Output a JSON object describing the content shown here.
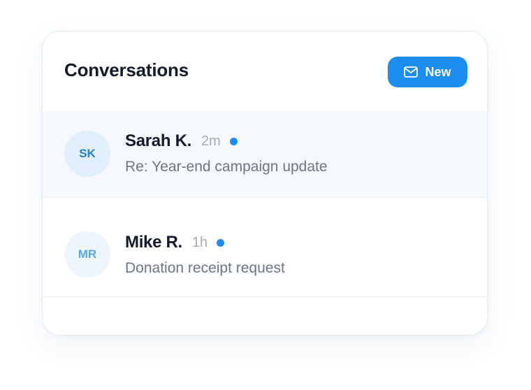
{
  "header": {
    "title": "Conversations",
    "new_button_label": "New",
    "new_button_icon": "mail-icon"
  },
  "colors": {
    "accent": "#1d8ef0",
    "unread_dot": "#1d8ef0",
    "selected_row_bg": "#f5f9fd"
  },
  "conversations": [
    {
      "initials": "SK",
      "name": "Sarah K.",
      "time": "2m",
      "unread": true,
      "preview": "Re: Year-end campaign update",
      "selected": true
    },
    {
      "initials": "MR",
      "name": "Mike R.",
      "time": "1h",
      "unread": true,
      "preview": "Donation receipt request",
      "selected": false
    }
  ]
}
